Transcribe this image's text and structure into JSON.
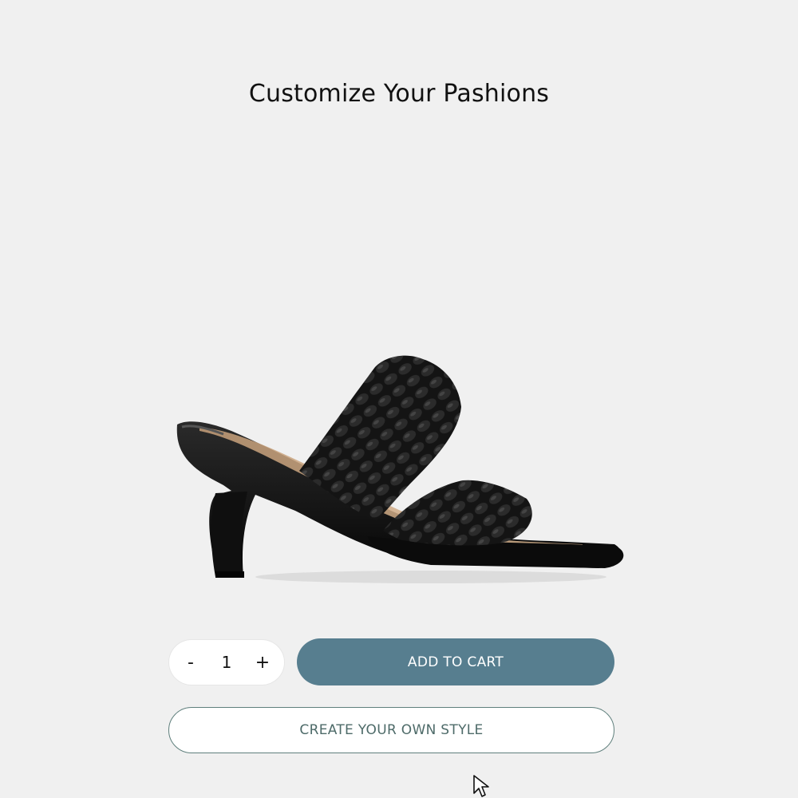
{
  "page": {
    "title": "Customize Your Pashions"
  },
  "product": {
    "image_icon": "black-braided-heel-sandal-image"
  },
  "quantity": {
    "decrement_label": "-",
    "value": "1",
    "increment_label": "+"
  },
  "actions": {
    "add_to_cart_label": "ADD TO CART",
    "create_style_label": "CREATE YOUR OWN STYLE"
  },
  "colors": {
    "background": "#f0f0f0",
    "primary_button": "#577e8f",
    "outline_button_border": "#5f7f7c",
    "outline_button_text": "#4e6b69"
  },
  "cursor": {
    "icon": "mouse-pointer-icon"
  }
}
